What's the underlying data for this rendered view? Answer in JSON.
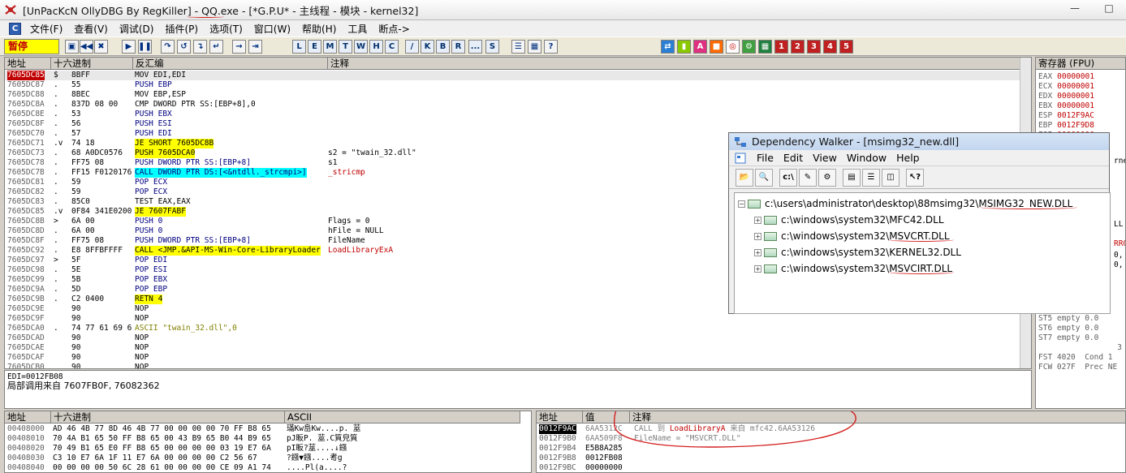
{
  "window": {
    "title": "[UnPacKcN OllyDBG By RegKiller] - QQ.exe - [*G.P.U* - 主线程 - 模块 - kernel32]"
  },
  "menu": [
    "文件(F)",
    "查看(V)",
    "调试(D)",
    "插件(P)",
    "选项(T)",
    "窗口(W)",
    "帮助(H)",
    "工具",
    "断点->"
  ],
  "toolbar": {
    "status": "暂停",
    "letters": [
      "L",
      "E",
      "M",
      "T",
      "W",
      "H",
      "C",
      "/",
      "K",
      "B",
      "R",
      "...",
      "S"
    ],
    "numbered": [
      "1",
      "2",
      "3",
      "4",
      "5"
    ]
  },
  "disasm": {
    "headers": [
      "地址",
      "十六进制",
      "反汇编",
      "注释"
    ],
    "rows": [
      {
        "addr": "7605DC85",
        "mark": "$",
        "hex": "8BFF",
        "dis": "MOV EDI,EDI",
        "cmt": ""
      },
      {
        "addr": "7605DC87",
        "mark": ".",
        "hex": "55",
        "dis": "PUSH EBP",
        "cmt": ""
      },
      {
        "addr": "7605DC88",
        "mark": ".",
        "hex": "8BEC",
        "dis": "MOV EBP,ESP",
        "cmt": ""
      },
      {
        "addr": "7605DC8A",
        "mark": ".",
        "hex": "837D 08 00",
        "dis": "CMP DWORD PTR SS:[EBP+8],0",
        "cmt": ""
      },
      {
        "addr": "7605DC8E",
        "mark": ".",
        "hex": "53",
        "dis": "PUSH EBX",
        "cmt": ""
      },
      {
        "addr": "7605DC8F",
        "mark": ".",
        "hex": "56",
        "dis": "PUSH ESI",
        "cmt": ""
      },
      {
        "addr": "7605DC70",
        "mark": ".",
        "hex": "57",
        "dis": "PUSH EDI",
        "cmt": ""
      },
      {
        "addr": "7605DC71",
        "mark": ".v",
        "hex": "74 18",
        "dis": "JE SHORT 7605DC8B",
        "cmt": ""
      },
      {
        "addr": "7605DC73",
        "mark": ".",
        "hex": "68 A0DC0576",
        "dis": "PUSH 7605DCA0",
        "cmt": "s2 = \"twain_32.dll\""
      },
      {
        "addr": "7605DC78",
        "mark": ".",
        "hex": "FF75 08",
        "dis": "PUSH DWORD PTR SS:[EBP+8]",
        "cmt": "s1"
      },
      {
        "addr": "7605DC7B",
        "mark": ".",
        "hex": "FF15 F0120176",
        "dis": "CALL DWORD PTR DS:[<&ntdll._strcmpi>]",
        "cmt": "_stricmp"
      },
      {
        "addr": "7605DC81",
        "mark": ".",
        "hex": "59",
        "dis": "POP ECX",
        "cmt": ""
      },
      {
        "addr": "7605DC82",
        "mark": ".",
        "hex": "59",
        "dis": "POP ECX",
        "cmt": ""
      },
      {
        "addr": "7605DC83",
        "mark": ".",
        "hex": "85C0",
        "dis": "TEST EAX,EAX",
        "cmt": ""
      },
      {
        "addr": "7605DC85",
        "mark": ".v",
        "hex": "0F84 341E0200",
        "dis": "JE 7607FABF",
        "cmt": ""
      },
      {
        "addr": "7605DC8B",
        "mark": ">",
        "hex": "6A 00",
        "dis": "PUSH 0",
        "cmt": "Flags = 0"
      },
      {
        "addr": "7605DC8D",
        "mark": ".",
        "hex": "6A 00",
        "dis": "PUSH 0",
        "cmt": "hFile = NULL"
      },
      {
        "addr": "7605DC8F",
        "mark": ".",
        "hex": "FF75 08",
        "dis": "PUSH DWORD PTR SS:[EBP+8]",
        "cmt": "FileName"
      },
      {
        "addr": "7605DC92",
        "mark": ".",
        "hex": "E8 8FFBFFFF",
        "dis": "CALL <JMP.&API-MS-Win-Core-LibraryLoader",
        "cmt": "LoadLibraryExA"
      },
      {
        "addr": "7605DC97",
        "mark": ">",
        "hex": "5F",
        "dis": "POP EDI",
        "cmt": ""
      },
      {
        "addr": "7605DC98",
        "mark": ".",
        "hex": "5E",
        "dis": "POP ESI",
        "cmt": ""
      },
      {
        "addr": "7605DC99",
        "mark": ".",
        "hex": "5B",
        "dis": "POP EBX",
        "cmt": ""
      },
      {
        "addr": "7605DC9A",
        "mark": ".",
        "hex": "5D",
        "dis": "POP EBP",
        "cmt": ""
      },
      {
        "addr": "7605DC9B",
        "mark": ".",
        "hex": "C2 0400",
        "dis": "RETN 4",
        "cmt": ""
      },
      {
        "addr": "7605DC9E",
        "mark": "",
        "hex": "90",
        "dis": "NOP",
        "cmt": ""
      },
      {
        "addr": "7605DC9F",
        "mark": "",
        "hex": "90",
        "dis": "NOP",
        "cmt": ""
      },
      {
        "addr": "7605DCA0",
        "mark": ".",
        "hex": "74 77 61 69 6",
        "dis": "ASCII \"twain_32.dll\",0",
        "cmt": ""
      },
      {
        "addr": "7605DCAD",
        "mark": "",
        "hex": "90",
        "dis": "NOP",
        "cmt": ""
      },
      {
        "addr": "7605DCAE",
        "mark": "",
        "hex": "90",
        "dis": "NOP",
        "cmt": ""
      },
      {
        "addr": "7605DCAF",
        "mark": "",
        "hex": "90",
        "dis": "NOP",
        "cmt": ""
      },
      {
        "addr": "7605DCB0",
        "mark": "",
        "hex": "90",
        "dis": "NOP",
        "cmt": ""
      }
    ]
  },
  "info": {
    "line1": "EDI=0012FB08",
    "line2": "局部调用来自 7607FB0F, 76082362"
  },
  "registers": {
    "header": "寄存器 (FPU)",
    "regs": [
      {
        "name": "EAX",
        "value": "00000001"
      },
      {
        "name": "ECX",
        "value": "00000001"
      },
      {
        "name": "EDX",
        "value": "00000001"
      },
      {
        "name": "EBX",
        "value": "00000001"
      },
      {
        "name": "ESP",
        "value": "0012F9AC"
      },
      {
        "name": "EBP",
        "value": "0012F9D8"
      },
      {
        "name": "ESI",
        "value": "00000000"
      }
    ],
    "side_fragments": [
      "rne",
      "LL",
      "RRO",
      "0,",
      "0,"
    ],
    "fpu": [
      "ST5 empty 0.0",
      "ST6 empty 0.0",
      "ST7 empty 0.0",
      "                 3",
      "FST 4020  Cond 1",
      "FCW 027F  Prec NE"
    ]
  },
  "dump": {
    "headers": [
      "地址",
      "十六进制",
      "ASCII"
    ],
    "rows": [
      {
        "addr": "00408000",
        "hex": "AD 46 4B 77 8D 46 4B 77 00 00 00 00 70 FF B8 65",
        "ascii": "璊Kw峊Kw....p. 莁"
      },
      {
        "addr": "00408010",
        "hex": "70 4A B1 65 50 FF B8 65 00 43 B9 65 B0 44 B9 65",
        "ascii": "pJ眅P. 莁.C筫皃筫"
      },
      {
        "addr": "00408020",
        "hex": "70 49 B1 65 E0 FF B8 65 00 00 00 00 03 19 E7 6A",
        "ascii": "pI眅?莁....↓鏹"
      },
      {
        "addr": "00408030",
        "hex": "C3 10 E7 6A 1F 11 E7 6A 00 00 00 00 C2 56 67",
        "ascii": "?鏹▼鏹....耉g"
      },
      {
        "addr": "00408040",
        "hex": "00 00 00 00 50 6C 28 61 00 00 00 00 CE 09 A1 74",
        "ascii": "....Pl(a....?"
      }
    ]
  },
  "stack": {
    "headers": [
      "地址",
      "值",
      "注释"
    ],
    "rows": [
      {
        "addr": "0012F9AC",
        "val": "6AA5312C",
        "cmt_a": "CALL 到 ",
        "cmt_b": "LoadLibraryA",
        "cmt_c": " 来自 mfc42.6AA53126"
      },
      {
        "addr": "0012F9B0",
        "val": "6AA509F8",
        "cmt_a": "FileName = \"MSVCRT.DLL\"",
        "cmt_b": "",
        "cmt_c": ""
      },
      {
        "addr": "0012F9B4",
        "val": "E5B8A285",
        "cmt_a": "",
        "cmt_b": "",
        "cmt_c": ""
      },
      {
        "addr": "0012F9B8",
        "val": "0012FB08",
        "cmt_a": "",
        "cmt_b": "",
        "cmt_c": ""
      },
      {
        "addr": "0012F9BC",
        "val": "00000000",
        "cmt_a": "",
        "cmt_b": "",
        "cmt_c": ""
      }
    ]
  },
  "depwalker": {
    "title": "Dependency Walker - [msimg32_new.dll]",
    "menu": [
      "File",
      "Edit",
      "View",
      "Window",
      "Help"
    ],
    "root": "c:\\users\\administrator\\desktop\\88msimg32\\MSIMG32_NEW.DLL",
    "children": [
      "c:\\windows\\system32\\MFC42.DLL",
      "c:\\windows\\system32\\MSVCRT.DLL",
      "c:\\windows\\system32\\KERNEL32.DLL",
      "c:\\windows\\system32\\MSVCIRT.DLL"
    ]
  },
  "colors": {
    "highlight_yellow": "#ffff00",
    "highlight_cyan": "#00ffff",
    "current_addr_bg": "#c00000",
    "annotation_red": "#d42020"
  }
}
